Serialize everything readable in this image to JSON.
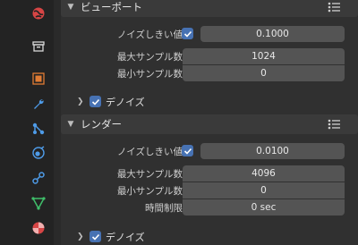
{
  "tabs": [
    {
      "name": "world",
      "icon": "world-icon",
      "color": "#d74545"
    },
    {
      "name": "collection",
      "icon": "collection-icon",
      "color": "#d8d8d8"
    },
    {
      "name": "object",
      "icon": "object-icon",
      "color": "#e07b33"
    },
    {
      "name": "modifiers",
      "icon": "wrench-icon",
      "color": "#4e9be8"
    },
    {
      "name": "particles",
      "icon": "particles-icon",
      "color": "#4e9be8"
    },
    {
      "name": "physics",
      "icon": "physics-icon",
      "color": "#4e9be8"
    },
    {
      "name": "constraints",
      "icon": "constraint-icon",
      "color": "#4e9be8"
    },
    {
      "name": "data",
      "icon": "mesh-data-icon",
      "color": "#3fbf6a"
    },
    {
      "name": "material",
      "icon": "material-icon",
      "color": "#d74545"
    }
  ],
  "viewport": {
    "title": "ビューポート",
    "noise_threshold_label": "ノイズしきい値",
    "noise_threshold_enabled": true,
    "noise_threshold_value": "0.1000",
    "max_samples_label": "最大サンプル数",
    "max_samples_value": "1024",
    "min_samples_label": "最小サンプル数",
    "min_samples_value": "0",
    "denoise_label": "デノイズ",
    "denoise_enabled": true
  },
  "render": {
    "title": "レンダー",
    "noise_threshold_label": "ノイズしきい値",
    "noise_threshold_enabled": true,
    "noise_threshold_value": "0.0100",
    "max_samples_label": "最大サンプル数",
    "max_samples_value": "4096",
    "min_samples_label": "最小サンプル数",
    "min_samples_value": "0",
    "time_limit_label": "時間制限",
    "time_limit_value": "0 sec",
    "denoise_label": "デノイズ",
    "denoise_enabled": true
  },
  "colors": {
    "accent": "#4772b3",
    "field": "#545454",
    "header": "#3a3a3a"
  }
}
